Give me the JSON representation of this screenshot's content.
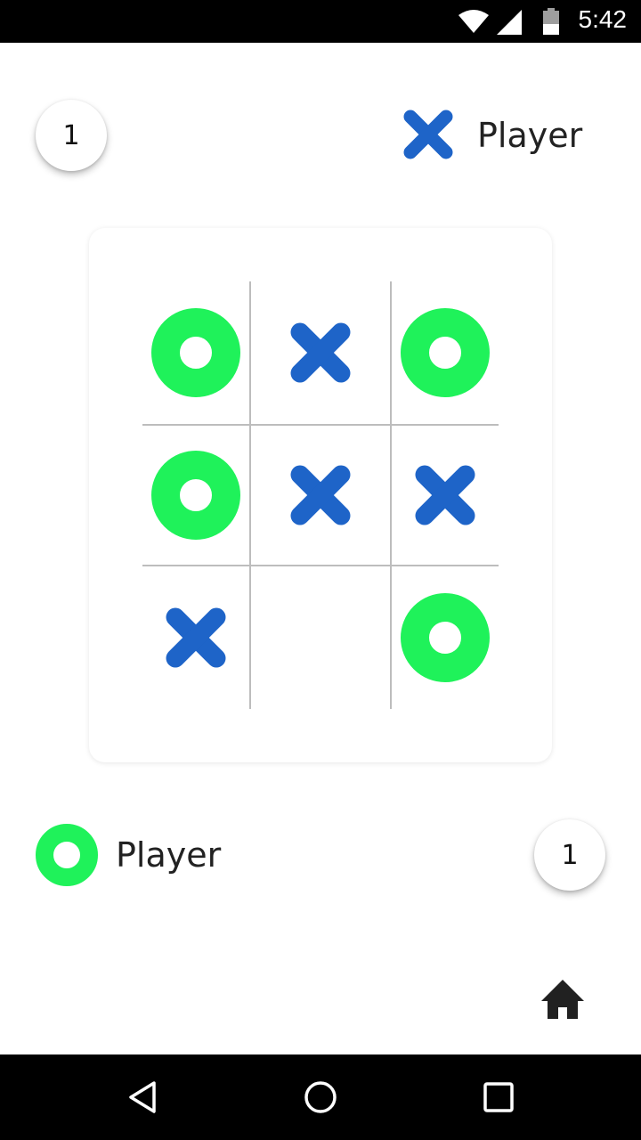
{
  "status_bar": {
    "time": "5:42",
    "icons": [
      "wifi-icon",
      "signal-icon",
      "battery-icon"
    ]
  },
  "top_player": {
    "score": "1",
    "symbol": "X",
    "label": "Player"
  },
  "bottom_player": {
    "score": "1",
    "symbol": "O",
    "label": "Player"
  },
  "board": {
    "cells": [
      [
        "O",
        "X",
        "O"
      ],
      [
        "O",
        "X",
        "X"
      ],
      [
        "X",
        "",
        "O"
      ]
    ]
  },
  "colors": {
    "x_mark": "#1E64C8",
    "o_mark": "#1FF25A",
    "grid_line": "#BDBDBD",
    "status_bar": "#000000"
  },
  "icons": {
    "home": "home-icon",
    "nav_back": "back-triangle-icon",
    "nav_home": "home-circle-icon",
    "nav_recents": "recents-square-icon"
  }
}
